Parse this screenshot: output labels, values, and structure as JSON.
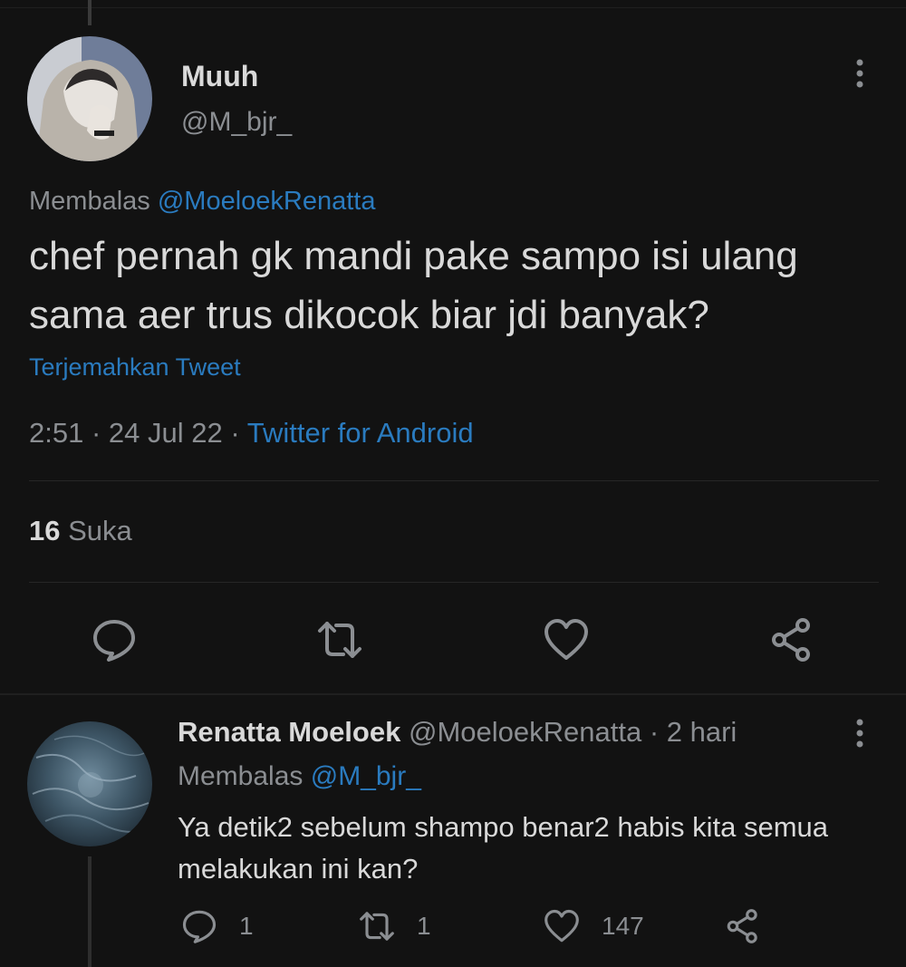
{
  "main_tweet": {
    "author_name": "Muuh",
    "author_handle": "@M_bjr_",
    "replying_prefix": "Membalas",
    "replying_to": "@MoeloekRenatta",
    "text_line1": "chef pernah gk mandi pake sampo isi ulang",
    "text_line2": "sama aer trus dikocok biar jdi banyak?",
    "translate_label": "Terjemahkan Tweet",
    "time": "2:51",
    "date": "24 Jul 22",
    "source": "Twitter for Android",
    "likes_count": "16",
    "likes_label": "Suka",
    "actions": {
      "reply_icon": "reply-bubble-icon",
      "retweet_icon": "retweet-icon",
      "like_icon": "heart-icon",
      "share_icon": "share-icon"
    }
  },
  "reply_tweet": {
    "author_name": "Renatta Moeloek",
    "author_handle": "@MoeloekRenatta",
    "age": "2 hari",
    "replying_prefix": "Membalas",
    "replying_to": "@M_bjr_",
    "text_line1": "Ya detik2 sebelum shampo benar2 habis kita semua",
    "text_line2": "melakukan ini kan?",
    "reply_count": "1",
    "retweet_count": "1",
    "like_count": "147"
  },
  "colors": {
    "background": "#121212",
    "text_primary": "#d9d9d9",
    "text_secondary": "#8b8e92",
    "link": "#2a7bbf"
  }
}
